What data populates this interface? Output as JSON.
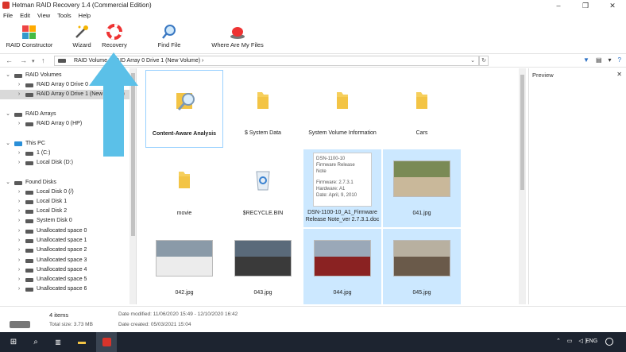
{
  "window": {
    "title": "Hetman RAID Recovery 1.4 (Commercial Edition)",
    "controls": [
      "–",
      "❐",
      "✕"
    ]
  },
  "menu": [
    "File",
    "Edit",
    "View",
    "Tools",
    "Help"
  ],
  "toolbar": {
    "raid_constructor": "RAID Constructor",
    "wizard": "Wizard",
    "recovery": "Recovery",
    "find_file": "Find File",
    "where_are_my_files": "Where Are My Files"
  },
  "address": {
    "crumbs": "RAID Volume  ›  RAID Array 0 Drive 1 (New Volume)  ›"
  },
  "tree": [
    {
      "label": "RAID Volumes",
      "level": 0,
      "expanded": true,
      "icon": "drive-icon"
    },
    {
      "label": "RAID Array 0 Drive 0",
      "level": 1,
      "icon": "drive-icon"
    },
    {
      "label": "RAID Array 0 Drive 1 (New Volume)",
      "level": 1,
      "icon": "drive-icon",
      "selected": true
    },
    {
      "label": "RAID Arrays",
      "level": 0,
      "expanded": true,
      "icon": "drive-icon"
    },
    {
      "label": "RAID Array 0 (HP)",
      "level": 1,
      "icon": "drive-icon"
    },
    {
      "label": "This PC",
      "level": 0,
      "expanded": true,
      "icon": "pc-icon"
    },
    {
      "label": "1 (C:)",
      "level": 1,
      "icon": "drive-icon"
    },
    {
      "label": "Local Disk (D:)",
      "level": 1,
      "icon": "drive-icon"
    },
    {
      "label": "Found Disks",
      "level": 0,
      "expanded": true,
      "icon": "drive-icon"
    },
    {
      "label": "Local Disk 0 (/)",
      "level": 1,
      "icon": "drive-icon"
    },
    {
      "label": "Local Disk 1",
      "level": 1,
      "icon": "drive-icon"
    },
    {
      "label": "Local Disk 2",
      "level": 1,
      "icon": "drive-icon"
    },
    {
      "label": "System Disk 0",
      "level": 1,
      "icon": "drive-icon"
    },
    {
      "label": "Unallocated space 0",
      "level": 1,
      "icon": "drive-icon"
    },
    {
      "label": "Unallocated space 1",
      "level": 1,
      "icon": "drive-icon"
    },
    {
      "label": "Unallocated space 2",
      "level": 1,
      "icon": "drive-icon"
    },
    {
      "label": "Unallocated space 3",
      "level": 1,
      "icon": "drive-icon"
    },
    {
      "label": "Unallocated space 4",
      "level": 1,
      "icon": "drive-icon"
    },
    {
      "label": "Unallocated space 5",
      "level": 1,
      "icon": "drive-icon"
    },
    {
      "label": "Unallocated space 6",
      "level": 1,
      "icon": "drive-icon"
    }
  ],
  "files": [
    {
      "name": "Content-Aware Analysis",
      "kind": "analysis"
    },
    {
      "name": "$ System Data",
      "kind": "folder"
    },
    {
      "name": "System Volume Information",
      "kind": "folder"
    },
    {
      "name": "Cars",
      "kind": "folder"
    },
    {
      "name": "movie",
      "kind": "folder"
    },
    {
      "name": "$RECYCLE.BIN",
      "kind": "recycle"
    },
    {
      "name": "DSN-1100-10_A1_Firmware Release Note_ver 2.7.3.1.doc",
      "kind": "doc",
      "selected": true
    },
    {
      "name": "041.jpg",
      "kind": "photo",
      "selected": true
    },
    {
      "name": "042.jpg",
      "kind": "photo"
    },
    {
      "name": "043.jpg",
      "kind": "photo"
    },
    {
      "name": "044.jpg",
      "kind": "photo",
      "selected": true
    },
    {
      "name": "045.jpg",
      "kind": "photo",
      "selected": true
    }
  ],
  "doc_preview": {
    "line1": "DSN-1100-10",
    "line2": "Firmware Release",
    "line3": "Note",
    "line4": "Firmware: 2.7.3.1",
    "line5": "Hardware: A1",
    "line6": "Date: April, 9, 2010"
  },
  "preview_pane": {
    "title": "Preview",
    "close": "✕"
  },
  "status": {
    "items": "4 items",
    "total_size": "Total size: 3.73 MB",
    "date_modified": "Date modified: 11/06/2020 15:49 - 12/10/2020 16:42",
    "date_created": "Date created: 05/03/2021 15:04"
  },
  "taskbar": {
    "lang": "ENG"
  },
  "colors": {
    "selection": "#cce8ff",
    "arrow": "#5bc0e8",
    "taskbar": "#1d2430"
  }
}
